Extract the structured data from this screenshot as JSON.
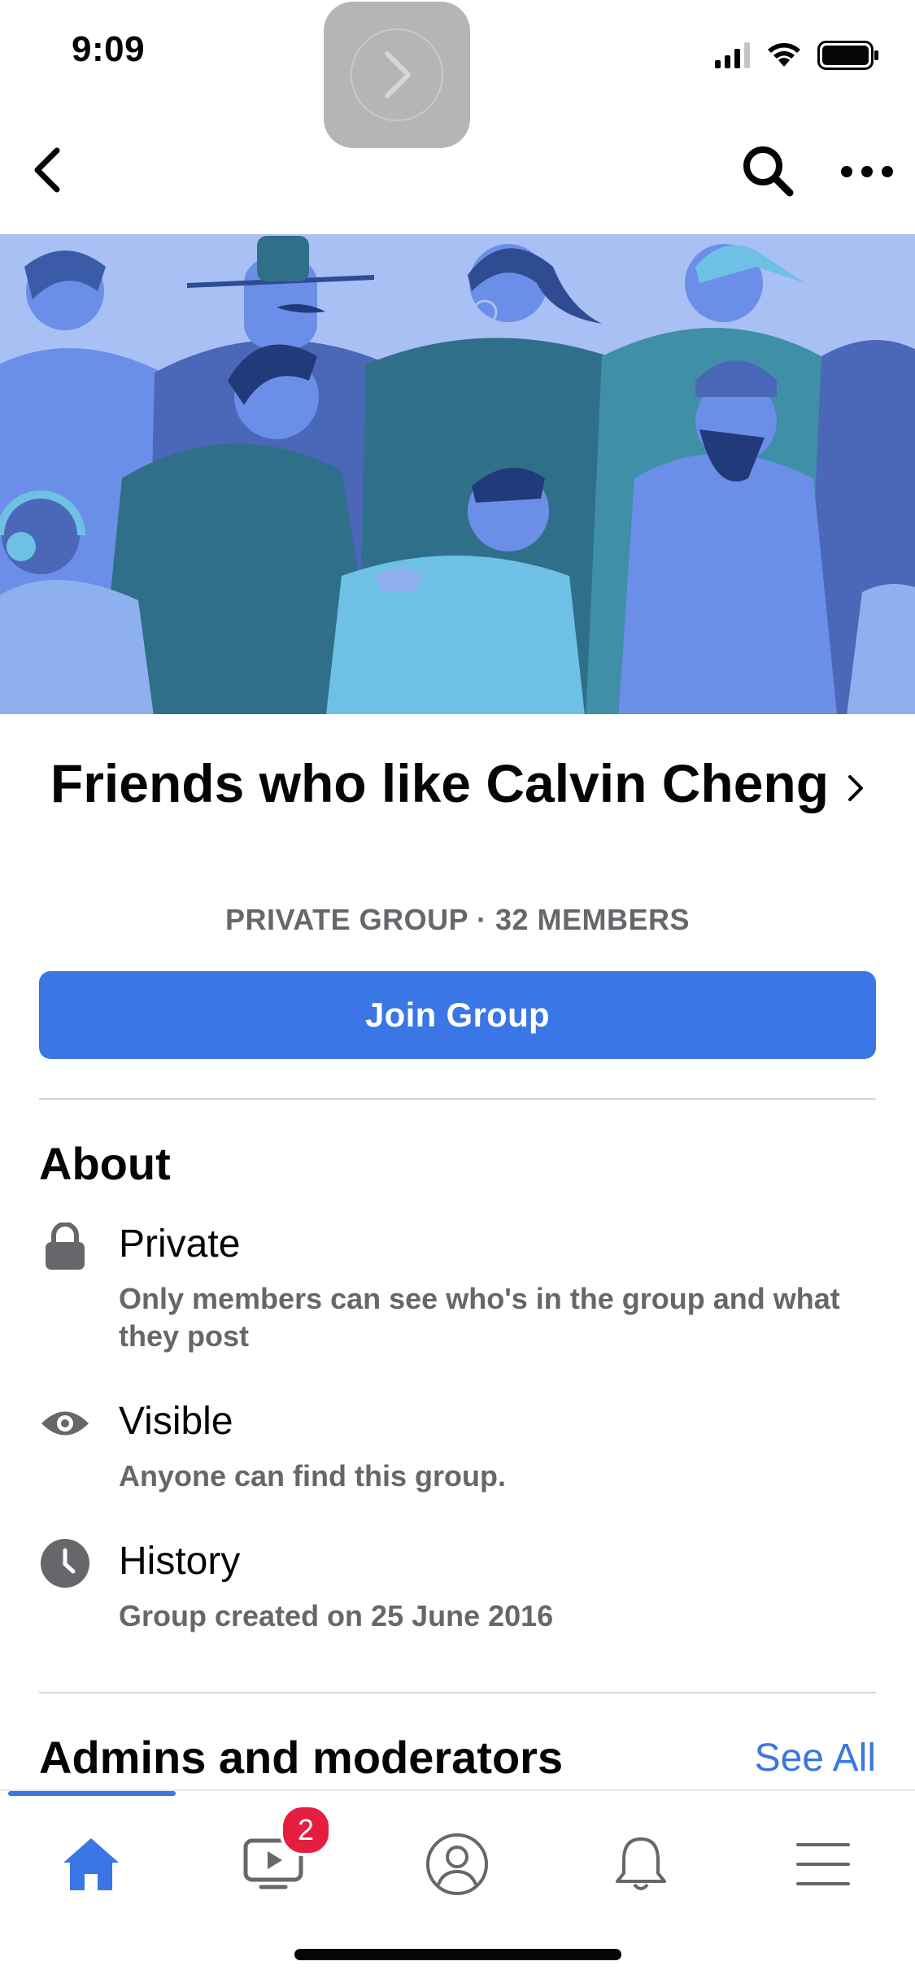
{
  "status_bar": {
    "time": "9:09",
    "signal_icon": "cellular-signal-icon",
    "wifi_icon": "wifi-icon",
    "battery_icon": "battery-icon"
  },
  "nav": {
    "back_icon": "back-chevron-icon",
    "search_icon": "search-icon",
    "more_icon": "more-horizontal-icon"
  },
  "group": {
    "title": "Friends who like Calvin Cheng",
    "meta": "PRIVATE GROUP · 32 MEMBERS",
    "join_label": "Join Group"
  },
  "about": {
    "heading": "About",
    "items": [
      {
        "icon": "lock-icon",
        "label": "Private",
        "description": "Only members can see who's in the group and what they post"
      },
      {
        "icon": "eye-icon",
        "label": "Visible",
        "description": "Anyone can find this group."
      },
      {
        "icon": "clock-icon",
        "label": "History",
        "description": "Group created on 25 June 2016"
      }
    ]
  },
  "admins": {
    "heading": "Admins and moderators",
    "see_all": "See All"
  },
  "tab_bar": {
    "tabs": [
      {
        "icon": "home-icon",
        "active": true
      },
      {
        "icon": "watch-video-icon",
        "badge": "2"
      },
      {
        "icon": "profile-icon"
      },
      {
        "icon": "bell-icon"
      },
      {
        "icon": "menu-icon"
      }
    ]
  },
  "colors": {
    "accent": "#3a76e5",
    "secondary_text": "#65676b",
    "badge": "#e41e3f",
    "cover_background": "#a9c0f5"
  }
}
